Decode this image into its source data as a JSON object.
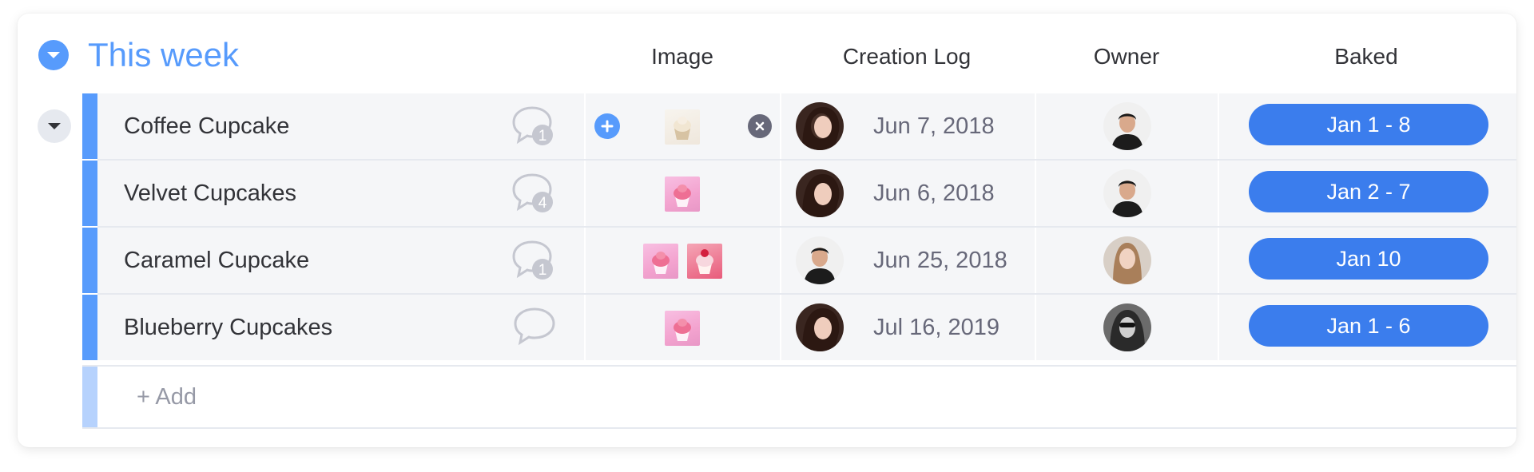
{
  "group": {
    "title": "This week",
    "color": "#579bfc"
  },
  "columns": {
    "image": "Image",
    "creation_log": "Creation Log",
    "owner": "Owner",
    "baked": "Baked"
  },
  "rows": [
    {
      "name": "Coffee Cupcake",
      "comments": "1",
      "created": "Jun 7, 2018",
      "baked": "Jan 1 - 8"
    },
    {
      "name": "Velvet Cupcakes",
      "comments": "4",
      "created": "Jun 6, 2018",
      "baked": "Jan 2 - 7"
    },
    {
      "name": "Caramel Cupcake",
      "comments": "1",
      "created": "Jun 25, 2018",
      "baked": "Jan 10"
    },
    {
      "name": "Blueberry Cupcakes",
      "comments": "",
      "created": "Jul 16, 2019",
      "baked": "Jan 1 - 6"
    }
  ],
  "add_row": {
    "label": "+ Add"
  },
  "colors": {
    "accent": "#579bfc",
    "pill": "#3b7ded",
    "row_bg": "#f5f6f8"
  },
  "icons": {
    "group_toggle": "chevron-down-icon",
    "row_toggle": "chevron-down-icon",
    "comment": "speech-bubble-icon",
    "add_file": "plus-icon",
    "remove_file": "close-icon"
  }
}
